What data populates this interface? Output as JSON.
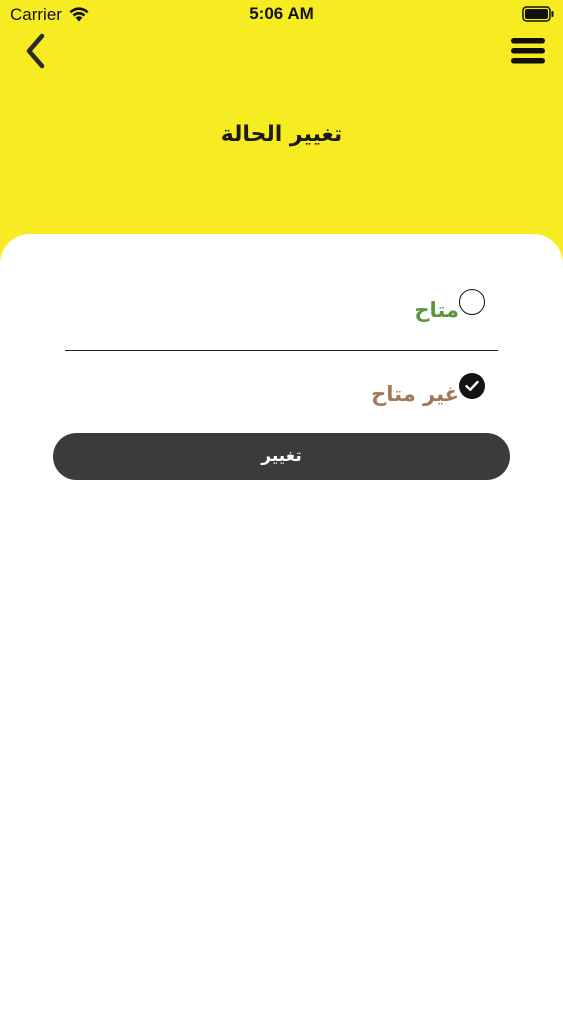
{
  "status_bar": {
    "carrier": "Carrier",
    "time": "5:06 AM"
  },
  "header": {
    "title": "تغيير الحالة",
    "back_icon": "chevron-left-icon",
    "menu_icon": "hamburger-menu-icon",
    "background_color": "#f7ec21"
  },
  "status_options": [
    {
      "label": "متاح",
      "selected": false,
      "color": "#5e9440"
    },
    {
      "label": "غير متاح",
      "selected": true,
      "color": "#a3785a"
    }
  ],
  "change_button": {
    "label": "تغيير",
    "background_color": "#3c3a3d"
  }
}
